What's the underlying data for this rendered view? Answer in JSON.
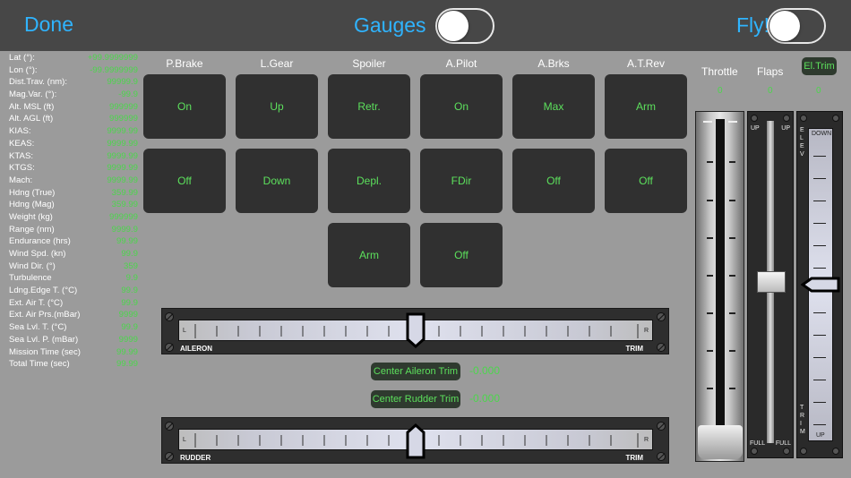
{
  "topbar": {
    "done_label": "Done",
    "gauges_label": "Gauges",
    "fly_label": "Fly!"
  },
  "stats": [
    {
      "label": "Lat (°):",
      "value": "+99.9999999"
    },
    {
      "label": "Lon (°):",
      "value": "-99.9999999"
    },
    {
      "label": "Dist.Trav. (nm):",
      "value": "99999.9"
    },
    {
      "label": "Mag.Var. (°):",
      "value": "-99.9"
    },
    {
      "label": "Alt. MSL (ft)",
      "value": "999999"
    },
    {
      "label": "Alt. AGL (ft)",
      "value": "999999"
    },
    {
      "label": "KIAS:",
      "value": "9999.99"
    },
    {
      "label": "KEAS:",
      "value": "9999.99"
    },
    {
      "label": "KTAS:",
      "value": "9999.99"
    },
    {
      "label": "KTGS:",
      "value": "9999.99"
    },
    {
      "label": "Mach:",
      "value": "9999.99"
    },
    {
      "label": "Hdng (True)",
      "value": "359.99"
    },
    {
      "label": "Hdng (Mag)",
      "value": "359.99"
    },
    {
      "label": "Weight (kg)",
      "value": "999999"
    },
    {
      "label": "Range (nm)",
      "value": "9999.9"
    },
    {
      "label": "Endurance (hrs)",
      "value": "99.99"
    },
    {
      "label": "Wind Spd. (kn)",
      "value": "99.9"
    },
    {
      "label": "Wind Dir. (°)",
      "value": "359"
    },
    {
      "label": "Turbulence",
      "value": "9.9"
    },
    {
      "label": "Ldng.Edge T. (°C)",
      "value": "99.9"
    },
    {
      "label": "Ext. Air T. (°C)",
      "value": "99.9"
    },
    {
      "label": "Ext. Air Prs.(mBar)",
      "value": "9999"
    },
    {
      "label": "Sea Lvl. T. (°C)",
      "value": "99.9"
    },
    {
      "label": "Sea Lvl. P. (mBar)",
      "value": "9999"
    },
    {
      "label": "Mission Time (sec)",
      "value": "99.99"
    },
    {
      "label": "Total Time (sec)",
      "value": "99.99"
    }
  ],
  "controls": {
    "columns": [
      "P.Brake",
      "L.Gear",
      "Spoiler",
      "A.Pilot",
      "A.Brks",
      "A.T.Rev"
    ],
    "row1": [
      "On",
      "Up",
      "Retr.",
      "On",
      "Max",
      "Arm"
    ],
    "row2": [
      "Off",
      "Down",
      "Depl.",
      "FDir",
      "Off",
      "Off"
    ],
    "row3": [
      "Arm",
      "Off"
    ]
  },
  "aileron_trim": {
    "caption_left": "AILERON",
    "caption_right": "TRIM",
    "left_letter": "L",
    "right_letter": "R",
    "position": 0.0
  },
  "rudder_trim": {
    "caption_left": "RUDDER",
    "caption_right": "TRIM",
    "left_letter": "L",
    "right_letter": "R",
    "position": 0.0
  },
  "center_aileron": {
    "label": "Center Aileron Trim",
    "value": "-0.000"
  },
  "center_rudder": {
    "label": "Center Rudder Trim",
    "value": "-0.000"
  },
  "right_panel": {
    "throttle_label": "Throttle",
    "throttle_value": "0",
    "flaps_label": "Flaps",
    "flaps_value": "0",
    "eltrim_label": "El.Trim",
    "eltrim_value": "0",
    "flaps_up": "UP",
    "flaps_full": "FULL",
    "eltrim_elev": "ELEV",
    "eltrim_trim": "TRIM",
    "eltrim_down": "DOWN",
    "eltrim_up": "UP"
  }
}
